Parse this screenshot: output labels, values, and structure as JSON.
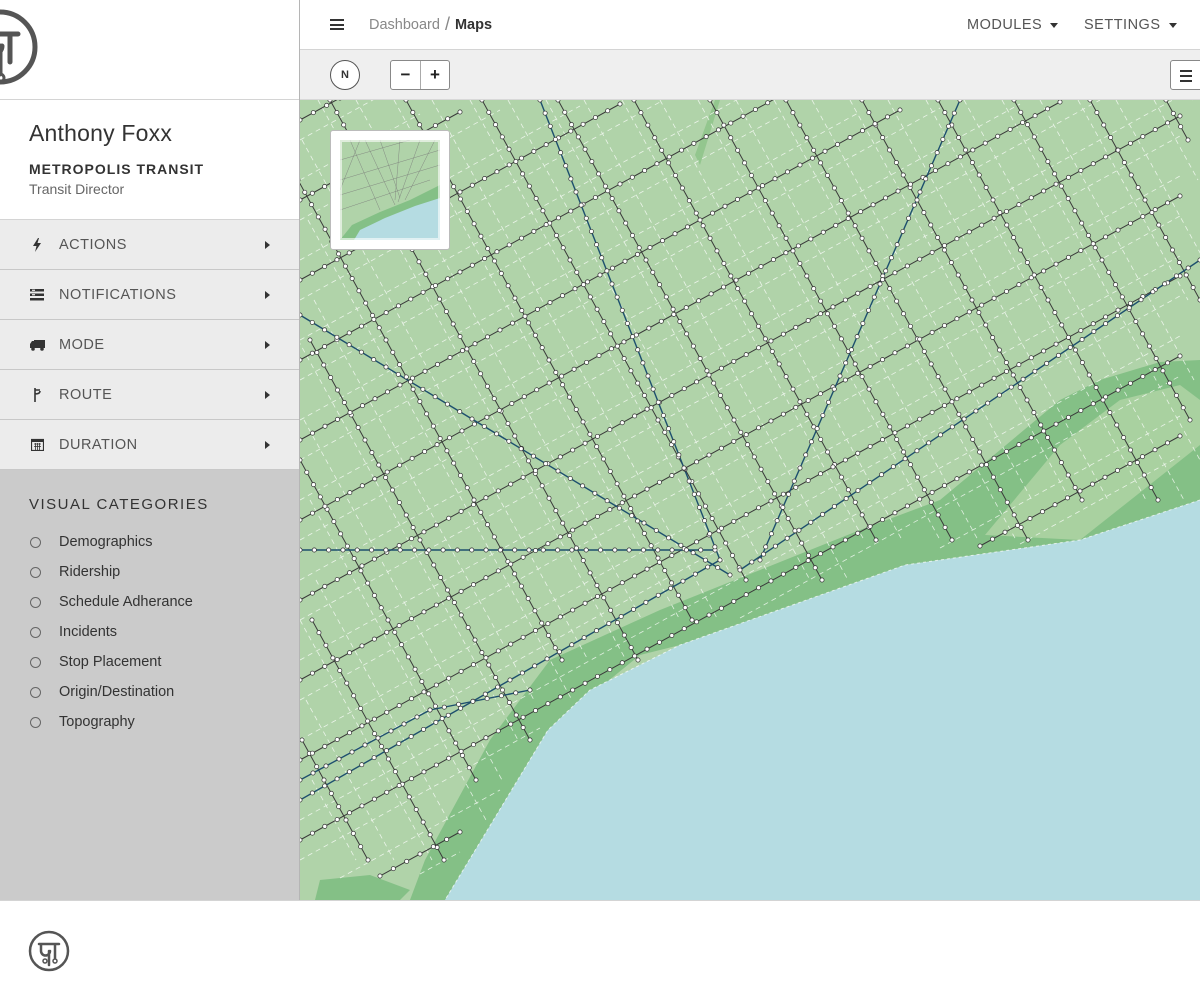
{
  "user": {
    "name": "Anthony Foxx",
    "organization": "METROPOLIS TRANSIT",
    "role": "Transit Director"
  },
  "sidebar": {
    "menu": [
      {
        "label": "ACTIONS",
        "icon": "bolt-icon"
      },
      {
        "label": "NOTIFICATIONS",
        "icon": "list-icon"
      },
      {
        "label": "MODE",
        "icon": "truck-icon"
      },
      {
        "label": "ROUTE",
        "icon": "route-icon"
      },
      {
        "label": "DURATION",
        "icon": "calendar-icon"
      }
    ],
    "categories_title": "VISUAL CATEGORIES",
    "categories": [
      "Demographics",
      "Ridership",
      "Schedule Adherance",
      "Incidents",
      "Stop Placement",
      "Origin/Destination",
      "Topography"
    ]
  },
  "header": {
    "breadcrumb": [
      "Dashboard",
      "Maps"
    ],
    "breadcrumb_separator": "/",
    "modules_label": "MODULES",
    "settings_label": "SETTINGS"
  },
  "toolbar": {
    "compass_label": "N",
    "zoom_out_label": "−",
    "zoom_in_label": "+"
  },
  "colors": {
    "land": "#b0d3a9",
    "park": "#84c086",
    "water": "#b5dce2",
    "sidebar_bg": "#cbcbcb",
    "menu_bg": "#ececec",
    "route_primary": "#1d4f6e",
    "route_secondary": "#333333"
  }
}
